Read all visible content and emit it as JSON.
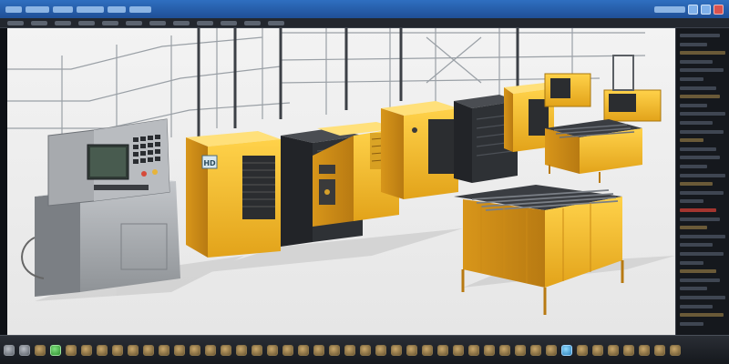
{
  "app": {
    "window_controls": [
      "minimize",
      "maximize",
      "close"
    ]
  },
  "colors": {
    "accent_titlebar": "#2f6fc0",
    "machine_yellow": "#f2b620",
    "panel_gray": "#a7aaae",
    "selected_button": "#8fd9ff",
    "status_green": "#7fe07f"
  },
  "toolbar": {
    "items": [
      "tool-1",
      "tool-2",
      "tool-3",
      "tool-4",
      "tool-5",
      "tool-6",
      "tool-7",
      "tool-8",
      "tool-9",
      "tool-10",
      "tool-11",
      "tool-12"
    ]
  },
  "scene": {
    "machine_label": "HD"
  },
  "right_panel": {
    "row_count": 34
  },
  "bottombar": {
    "buttons": [
      {
        "kind": "gray"
      },
      {
        "kind": "gray"
      },
      {
        "kind": "normal"
      },
      {
        "kind": "green"
      },
      {
        "kind": "normal"
      },
      {
        "kind": "normal"
      },
      {
        "kind": "normal"
      },
      {
        "kind": "normal"
      },
      {
        "kind": "normal"
      },
      {
        "kind": "normal"
      },
      {
        "kind": "normal"
      },
      {
        "kind": "normal"
      },
      {
        "kind": "normal"
      },
      {
        "kind": "normal"
      },
      {
        "kind": "normal"
      },
      {
        "kind": "normal"
      },
      {
        "kind": "normal"
      },
      {
        "kind": "normal"
      },
      {
        "kind": "normal"
      },
      {
        "kind": "normal"
      },
      {
        "kind": "normal"
      },
      {
        "kind": "normal"
      },
      {
        "kind": "normal"
      },
      {
        "kind": "normal"
      },
      {
        "kind": "normal"
      },
      {
        "kind": "normal"
      },
      {
        "kind": "normal"
      },
      {
        "kind": "normal"
      },
      {
        "kind": "normal"
      },
      {
        "kind": "normal"
      },
      {
        "kind": "normal"
      },
      {
        "kind": "normal"
      },
      {
        "kind": "normal"
      },
      {
        "kind": "normal"
      },
      {
        "kind": "normal"
      },
      {
        "kind": "normal"
      },
      {
        "kind": "active"
      },
      {
        "kind": "normal"
      },
      {
        "kind": "normal"
      },
      {
        "kind": "normal"
      },
      {
        "kind": "normal"
      },
      {
        "kind": "normal"
      },
      {
        "kind": "normal"
      },
      {
        "kind": "normal"
      }
    ]
  }
}
